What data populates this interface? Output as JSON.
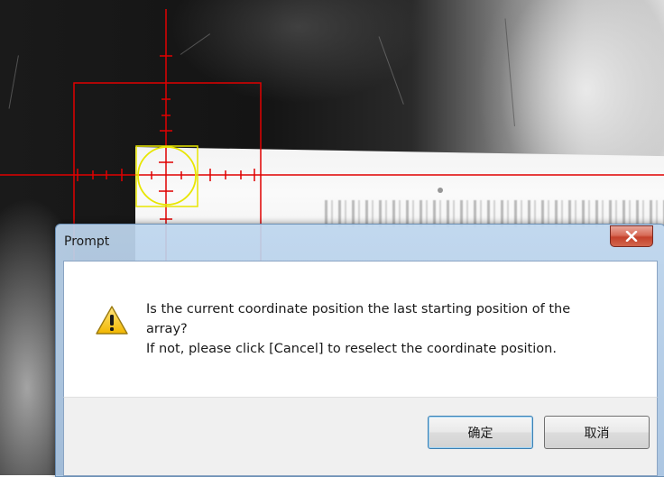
{
  "camera": {
    "crosshair_color": "#e00000",
    "target_circle_color": "#e8e600"
  },
  "dialog": {
    "title": "Prompt",
    "icon": "warning-icon",
    "message_line1": "Is the current coordinate position the last starting position of the",
    "message_line2": "array?",
    "message_line3": "If not, please click [Cancel] to reselect the coordinate position.",
    "ok_label": "确定",
    "cancel_label": "取消",
    "close_icon": "close-icon"
  }
}
